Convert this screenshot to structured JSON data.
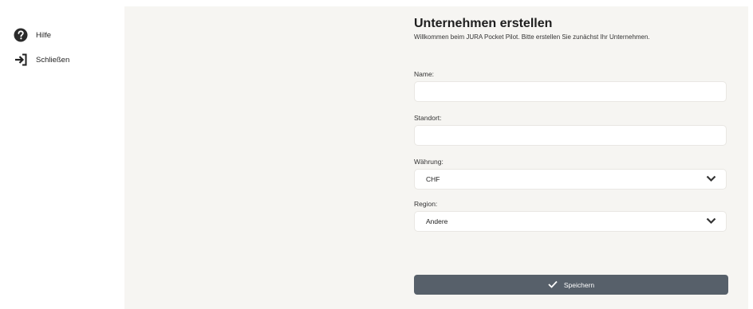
{
  "sidebar": {
    "items": [
      {
        "label": "Hilfe",
        "icon": "help-circle-icon"
      },
      {
        "label": "Schließen",
        "icon": "exit-arrow-icon"
      }
    ]
  },
  "form": {
    "title": "Unternehmen erstellen",
    "subtitle": "Willkommen beim JURA Pocket Pilot. Bitte erstellen Sie zunächst Ihr Unternehmen.",
    "name": {
      "label": "Name:",
      "value": ""
    },
    "standort": {
      "label": "Standort:",
      "value": ""
    },
    "waehrung": {
      "label": "Währung:",
      "value": "CHF"
    },
    "region": {
      "label": "Region:",
      "value": "Andere"
    },
    "save_label": "Speichern"
  },
  "colors": {
    "background": "#f6f5f2",
    "button": "#57606a"
  }
}
